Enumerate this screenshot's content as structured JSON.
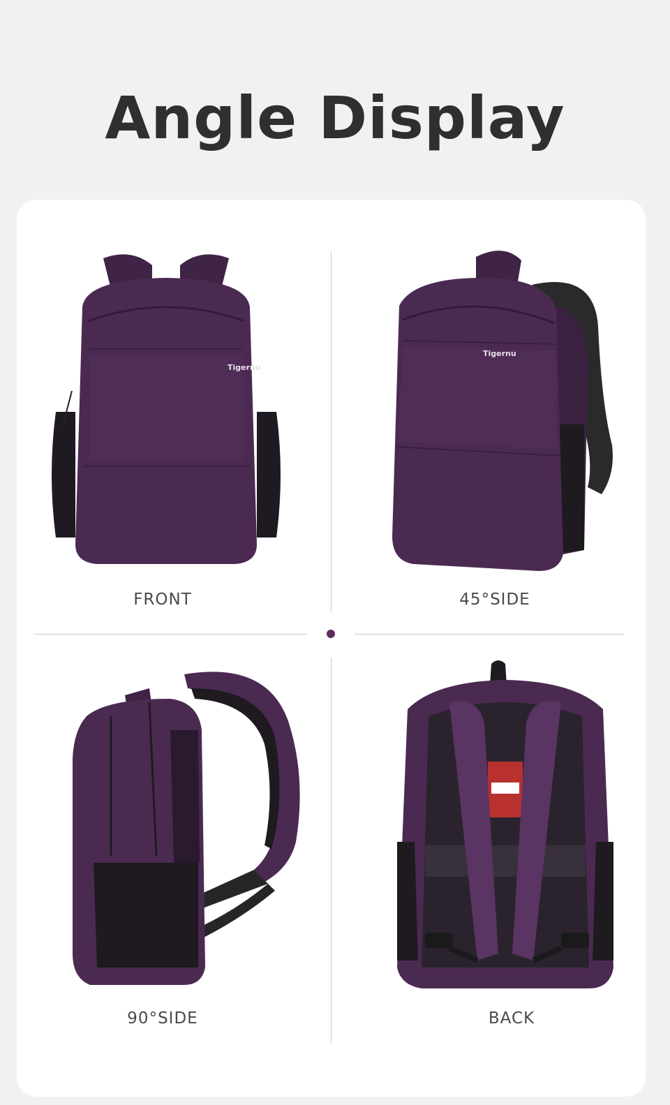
{
  "title": "Angle Display",
  "brand": "Tigernu",
  "colors": {
    "background": "#f2f1f2",
    "card": "#ffffff",
    "bag_purple": "#4b2a52",
    "bag_dark": "#2b1a30",
    "accent_dot": "#5b2b5d"
  },
  "views": [
    {
      "label": "FRONT"
    },
    {
      "label": "45°SIDE"
    },
    {
      "label": "90°SIDE"
    },
    {
      "label": "BACK"
    }
  ]
}
